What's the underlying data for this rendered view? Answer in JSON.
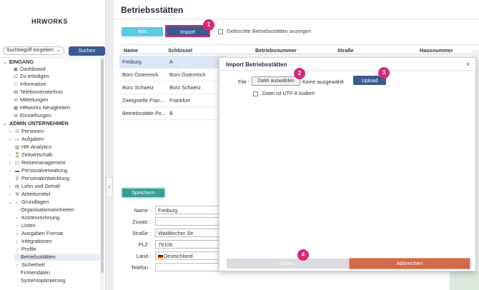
{
  "app": {
    "logo_text": "HRWORKS"
  },
  "search": {
    "select_value": "Suchbegriff eingeben",
    "button_label": "Suchen"
  },
  "nav": {
    "items": [
      {
        "label": "EINGANG",
        "icon": "chevron-down-icon"
      },
      {
        "label": "Dashboard",
        "icon": "dashboard-icon"
      },
      {
        "label": "Zu erledigen",
        "icon": "todo-icon"
      },
      {
        "label": "Information",
        "icon": "info-icon"
      },
      {
        "label": "Telefonverzeichnis",
        "icon": "phone-book-icon"
      },
      {
        "label": "Mitteilungen",
        "icon": "message-icon"
      },
      {
        "label": "HRworks Neuigkeiten",
        "icon": "news-icon"
      },
      {
        "label": "Einstellungen",
        "icon": "settings-icon"
      },
      {
        "label": "ADMIN UNTERNEHMEN",
        "icon": "chevron-down-icon"
      },
      {
        "label": "Personen",
        "icon": "people-icon"
      },
      {
        "label": "Aufgaben",
        "icon": "tasks-icon"
      },
      {
        "label": "HR-Analytics",
        "icon": "analytics-icon"
      },
      {
        "label": "Zeitwirtschaft",
        "icon": "time-icon"
      },
      {
        "label": "Reisemanagement",
        "icon": "travel-icon"
      },
      {
        "label": "Personalverwaltung",
        "icon": "admin-icon"
      },
      {
        "label": "Personalentwicklung",
        "icon": "development-icon"
      },
      {
        "label": "Lohn und Gehalt",
        "icon": "payroll-icon"
      },
      {
        "label": "Arbeitsmittel",
        "icon": "tools-icon"
      },
      {
        "label": "Grundlagen",
        "icon": "home-icon"
      },
      {
        "label": "Organisationseinheiten",
        "icon": ""
      },
      {
        "label": "Kostenrechnung",
        "icon": "chevron-right-icon"
      },
      {
        "label": "Listen",
        "icon": "chevron-right-icon"
      },
      {
        "label": "Ausgaben Format",
        "icon": "chevron-right-icon"
      },
      {
        "label": "Integrationen",
        "icon": "chevron-right-icon"
      },
      {
        "label": "Profile",
        "icon": "chevron-right-icon"
      },
      {
        "label": "Betriebsstätten",
        "icon": ""
      },
      {
        "label": "Sicherheit",
        "icon": "chevron-right-icon"
      },
      {
        "label": "Firmendaten",
        "icon": ""
      },
      {
        "label": "Systemoptimierung",
        "icon": ""
      }
    ]
  },
  "page": {
    "title": "Betriebsstätten",
    "new_label": "Neu",
    "import_label": "Import",
    "show_deleted_label": "Gelöschte Betriebsstätten anzeigen"
  },
  "table": {
    "columns": [
      "Name",
      "Schlüssel",
      "Betriebsnummer",
      "Straße",
      "Hausnummer"
    ],
    "rows": [
      {
        "name": "Freiburg",
        "key": "A"
      },
      {
        "name": "Büro Österreich",
        "key": "Büro Österreich"
      },
      {
        "name": "Büro Schweiz",
        "key": "Büro Schweiz"
      },
      {
        "name": "Zweigstelle Fran...",
        "key": "Frankfurt"
      },
      {
        "name": "Betriebsstätte Po...",
        "key": "B"
      }
    ]
  },
  "form": {
    "save_label": "Speichern",
    "labels": {
      "name": "Name :",
      "zusatz": "Zusatz :",
      "strasse": "Straße :",
      "plz": "PLZ :",
      "land": "Land :",
      "telefon": "Telefon :"
    },
    "values": {
      "name": "Freiburg",
      "zusatz": "",
      "strasse": "Waldkircher Str.",
      "plz": "79106",
      "land": "Deutschland",
      "telefon": ""
    }
  },
  "modal": {
    "title": "Import Betriebsstätten",
    "close_glyph": "×",
    "file_label": "File :",
    "choose_file_label": "Datei auswählen",
    "no_file_label": "Keine ausgewählt",
    "upload_label": "Upload",
    "utf8_label": "Datei ist UTF-8 kodiert",
    "import_label": "Import",
    "cancel_label": "Abbrechen"
  },
  "badges": [
    "1",
    "2",
    "3",
    "4"
  ],
  "colors": {
    "primary": "#3b5a8f",
    "accent": "#5bc8e4",
    "badge": "#d6297a",
    "save": "#3a9d95",
    "cancel": "#d26a49"
  }
}
